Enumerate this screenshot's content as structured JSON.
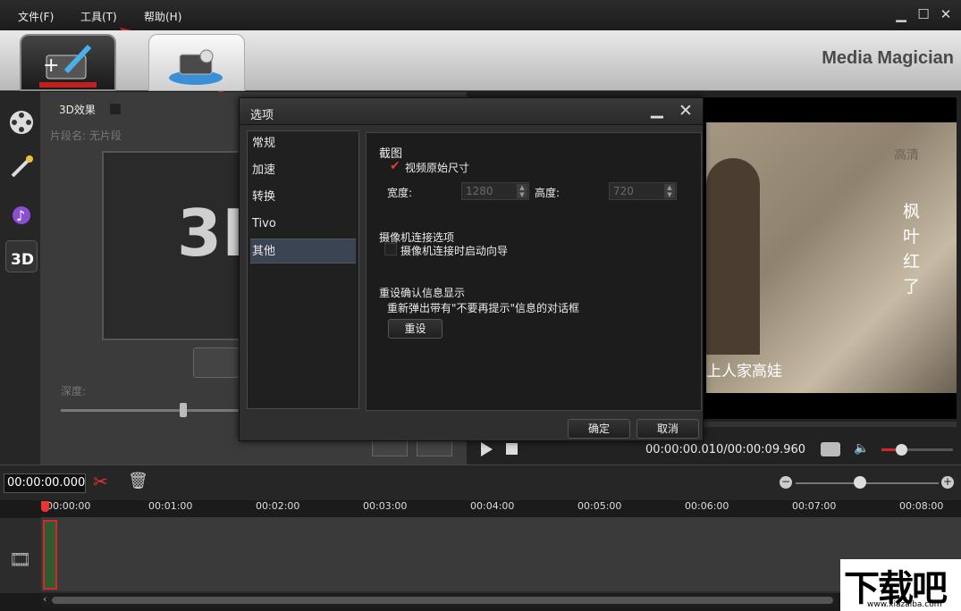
{
  "menu": {
    "file": "文件(F)",
    "tools": "工具(T)",
    "help": "帮助(H)"
  },
  "brand": "Media Magician",
  "edit_panel": {
    "effect_3d_label": "3D效果",
    "clip_name_label": "片段名: 无片段",
    "depth_label": "深度:",
    "big_3d_text": "3D"
  },
  "preview": {
    "watermark_top": "高清",
    "vertical_text": [
      "枫",
      "叶",
      "红",
      "了"
    ],
    "subtitle": "上人家高娃",
    "time_display": "00:00:00.010/00:00:09.960"
  },
  "timeline": {
    "current_time": "00:00:00.000",
    "ticks": [
      "00:00:00",
      "00:01:00",
      "00:02:00",
      "00:03:00",
      "00:04:00",
      "00:05:00",
      "00:06:00",
      "00:07:00",
      "00:08:00"
    ]
  },
  "dialog": {
    "title": "选项",
    "nav": [
      "常规",
      "加速",
      "转换",
      "Tivo",
      "其他"
    ],
    "active_nav": 4,
    "screenshot_section": "截图",
    "original_size_label": "视频原始尺寸",
    "width_label": "宽度:",
    "width_value": "1280",
    "height_label": "高度:",
    "height_value": "720",
    "camera_section": "摄像机连接选项",
    "camera_wizard_label": "摄像机连接时启动向导",
    "reset_section": "重设确认信息显示",
    "reset_desc": "重新弹出带有\"不要再提示\"信息的对话框",
    "reset_button": "重设",
    "ok_button": "确定",
    "cancel_button": "取消"
  },
  "watermark": {
    "logo_text": "下载吧",
    "url": "www.xiazaiba.com"
  }
}
